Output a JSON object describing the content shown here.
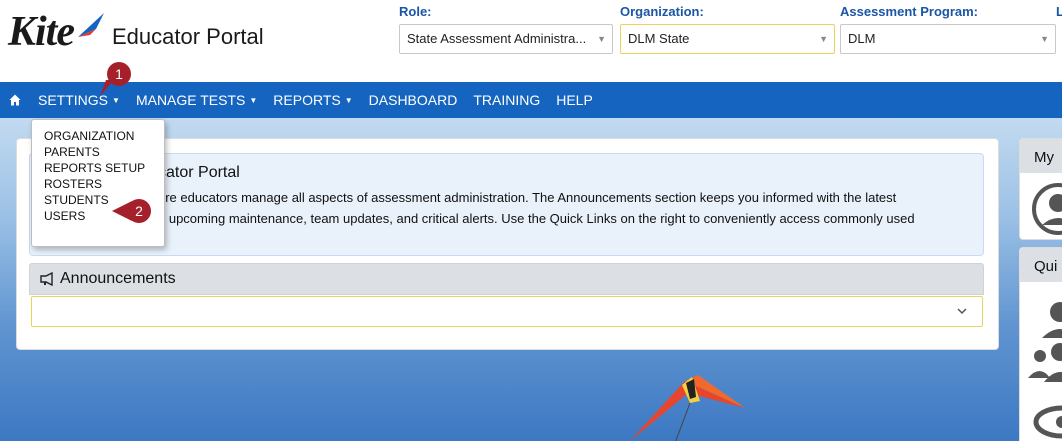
{
  "header": {
    "logo_text": "Kite",
    "portal_title": "Educator Portal",
    "role_label": "Role:",
    "role_value": "State Assessment Administra...",
    "org_label": "Organization:",
    "org_value": "DLM State",
    "program_label": "Assessment Program:",
    "program_value": "DLM",
    "edge_label": "L"
  },
  "nav": {
    "items": [
      "SETTINGS",
      "MANAGE TESTS",
      "REPORTS",
      "DASHBOARD",
      "TRAINING",
      "HELP"
    ]
  },
  "settings_menu": {
    "items": [
      "ORGANIZATION",
      "PARENTS",
      "REPORTS SETUP",
      "ROSTERS",
      "STUDENTS",
      "USERS"
    ]
  },
  "welcome": {
    "title_visible": "cator Portal",
    "line1": "ere educators manage all aspects of assessment administration. The Announcements section keeps you informed with the latest",
    "line2": "g upcoming maintenance, team updates, and critical alerts. Use the Quick Links on the right to conveniently access commonly used"
  },
  "announcements": {
    "title": "Announcements",
    "value": ""
  },
  "side": {
    "my_title": "My",
    "quick_title": "Qui"
  },
  "markers": {
    "one": "1",
    "two": "2"
  },
  "colors": {
    "nav_bg": "#1565c0",
    "label_blue": "#1b55a5",
    "marker_red": "#a5202a"
  }
}
